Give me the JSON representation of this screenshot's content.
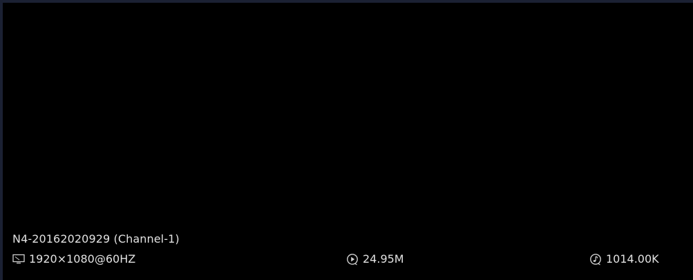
{
  "channel": {
    "title": "N4-20162020929 (Channel-1)"
  },
  "stats": {
    "resolution": {
      "icon": "monitor-icon",
      "value": "1920×1080@60HZ"
    },
    "video_bitrate": {
      "icon": "play-circle-icon",
      "value": "24.95M"
    },
    "audio_bitrate": {
      "icon": "music-note-icon",
      "value": "1014.00K"
    }
  },
  "colors": {
    "panel_background": "#000000",
    "frame_border": "#1b2133",
    "text": "#e2e2e2"
  }
}
